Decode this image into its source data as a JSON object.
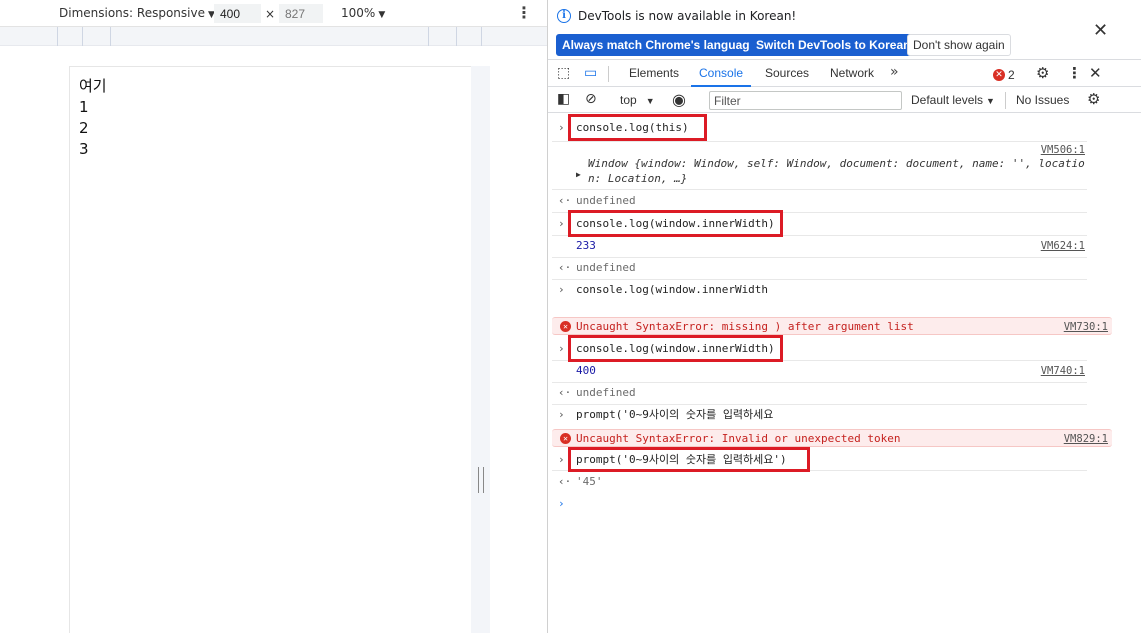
{
  "device_toolbar": {
    "dimensions_label": "Dimensions: Responsive",
    "width_value": "400",
    "times": "×",
    "height_placeholder": "827",
    "zoom_label": "100%"
  },
  "viewport_content": {
    "lines": [
      "여기",
      "1",
      "2",
      "3"
    ]
  },
  "infobar": {
    "message": "DevTools is now available in Korean!",
    "btn_match": "Always match Chrome's language",
    "btn_switch": "Switch DevTools to Korean",
    "btn_dismiss": "Don't show again"
  },
  "tabs": {
    "elements": "Elements",
    "console": "Console",
    "sources": "Sources",
    "network": "Network",
    "error_count": "2"
  },
  "console_toolbar": {
    "context": "top",
    "filter_placeholder": "Filter",
    "levels": "Default levels",
    "issues": "No Issues"
  },
  "log": {
    "cmd1": "console.log(this)",
    "src_506": "VM506:1",
    "window_line1": "Window {window: Window, self: Window, document: document, name: '', locatio",
    "window_line2": "n: Location, …}",
    "undefined1": "undefined",
    "cmd2": "console.log(window.innerWidth)",
    "out_233": "233",
    "src_624": "VM624:1",
    "undefined2": "undefined",
    "cmd3": "console.log(window.innerWidth",
    "err1": "Uncaught SyntaxError: missing ) after argument list",
    "src_730": "VM730:1",
    "cmd4": "console.log(window.innerWidth)",
    "out_400": "400",
    "src_740": "VM740:1",
    "undefined3": "undefined",
    "cmd5": "prompt('0~9사이의 숫자를 입력하세요",
    "err2": "Uncaught SyntaxError: Invalid or unexpected token",
    "src_829": "VM829:1",
    "cmd6": "prompt('0~9사이의 숫자를 입력하세요')",
    "result": "'45'"
  },
  "colors": {
    "highlight": "#dc1b25",
    "accent": "#1a73e8",
    "error": "#d93025"
  }
}
